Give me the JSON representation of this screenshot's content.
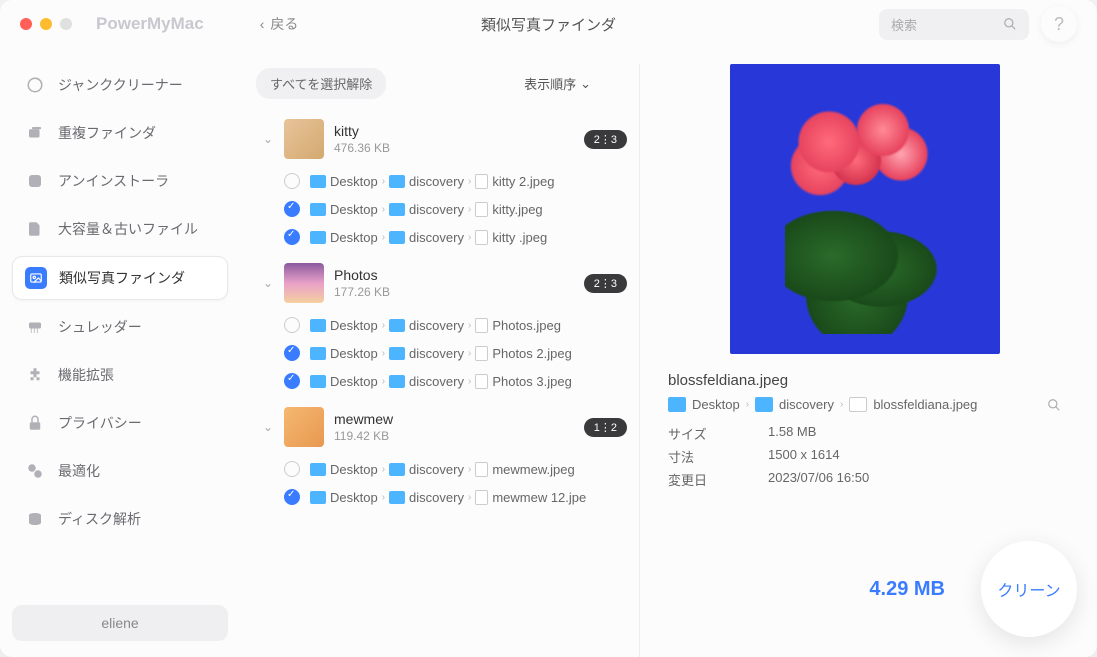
{
  "app_title": "PowerMyMac",
  "back_label": "戻る",
  "window_title": "類似写真ファインダ",
  "search_placeholder": "検索",
  "help_label": "?",
  "sidebar": {
    "items": [
      {
        "label": "ジャンククリーナー"
      },
      {
        "label": "重複ファインダ"
      },
      {
        "label": "アンインストーラ"
      },
      {
        "label": "大容量＆古いファイル"
      },
      {
        "label": "類似写真ファインダ"
      },
      {
        "label": "シュレッダー"
      },
      {
        "label": "機能拡張"
      },
      {
        "label": "プライバシー"
      },
      {
        "label": "最適化"
      },
      {
        "label": "ディスク解析"
      }
    ],
    "user": "eliene"
  },
  "list": {
    "deselect_label": "すべてを選択解除",
    "sort_label": "表示順序",
    "groups": [
      {
        "name": "kitty",
        "size": "476.36 KB",
        "badge": "2⋮3",
        "files": [
          {
            "checked": false,
            "path": [
              "Desktop",
              "discovery"
            ],
            "file": "kitty 2.jpeg"
          },
          {
            "checked": true,
            "path": [
              "Desktop",
              "discovery"
            ],
            "file": "kitty.jpeg"
          },
          {
            "checked": true,
            "path": [
              "Desktop",
              "discovery"
            ],
            "file": "kitty .jpeg"
          }
        ]
      },
      {
        "name": "Photos",
        "size": "177.26 KB",
        "badge": "2⋮3",
        "files": [
          {
            "checked": false,
            "path": [
              "Desktop",
              "discovery"
            ],
            "file": "Photos.jpeg"
          },
          {
            "checked": true,
            "path": [
              "Desktop",
              "discovery"
            ],
            "file": "Photos 2.jpeg"
          },
          {
            "checked": true,
            "path": [
              "Desktop",
              "discovery"
            ],
            "file": "Photos 3.jpeg"
          }
        ]
      },
      {
        "name": "mewmew",
        "size": "119.42 KB",
        "badge": "1⋮2",
        "files": [
          {
            "checked": false,
            "path": [
              "Desktop",
              "discovery"
            ],
            "file": "mewmew.jpeg"
          },
          {
            "checked": true,
            "path": [
              "Desktop",
              "discovery"
            ],
            "file": "mewmew 12.jpe"
          }
        ]
      }
    ]
  },
  "preview": {
    "filename": "blossfeldiana.jpeg",
    "path": [
      "Desktop",
      "discovery",
      "blossfeldiana.jpeg"
    ],
    "meta": {
      "size_label": "サイズ",
      "size_value": "1.58 MB",
      "dim_label": "寸法",
      "dim_value": "1500 x 1614",
      "date_label": "変更日",
      "date_value": "2023/07/06 16:50"
    }
  },
  "footer": {
    "total_size": "4.29 MB",
    "clean_label": "クリーン"
  }
}
